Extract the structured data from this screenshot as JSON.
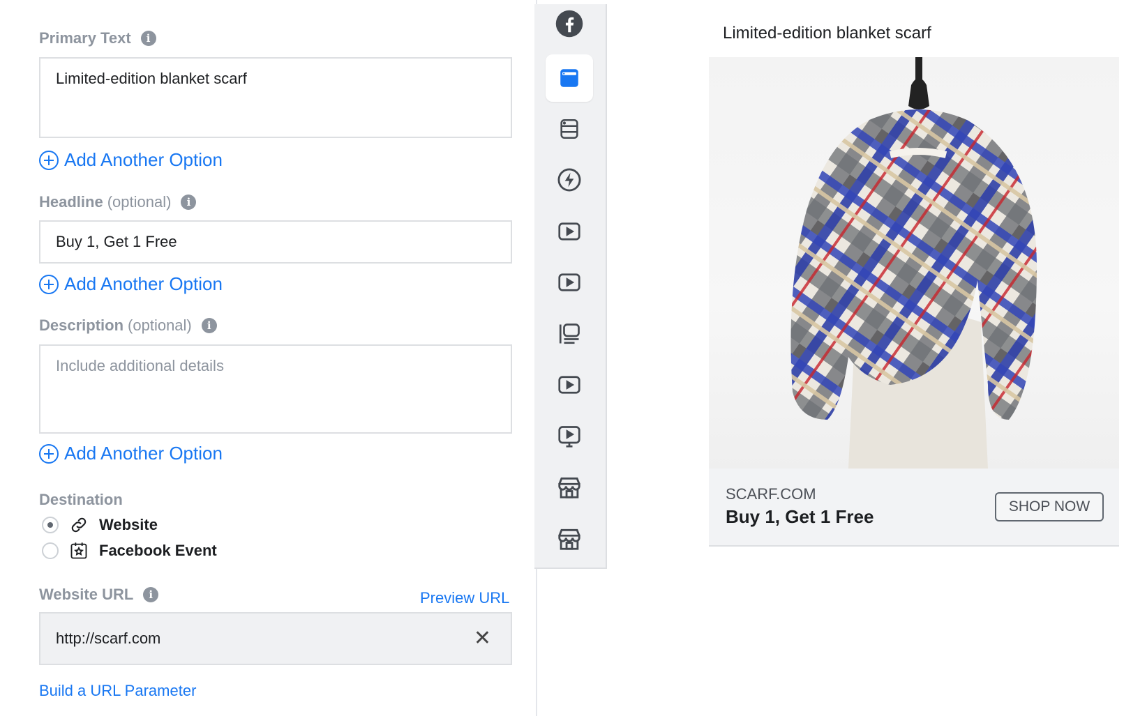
{
  "form": {
    "primary_text": {
      "label": "Primary Text",
      "value": "Limited-edition blanket scarf",
      "add_option": "Add Another Option"
    },
    "headline": {
      "label": "Headline",
      "optional": "(optional)",
      "value": "Buy 1, Get 1 Free",
      "add_option": "Add Another Option"
    },
    "description": {
      "label": "Description",
      "optional": "(optional)",
      "placeholder": "Include additional details",
      "add_option": "Add Another Option"
    },
    "destination": {
      "label": "Destination",
      "options": [
        {
          "label": "Website",
          "icon": "link-icon",
          "selected": true
        },
        {
          "label": "Facebook Event",
          "icon": "calendar-star-icon",
          "selected": false
        }
      ]
    },
    "website_url": {
      "label": "Website URL",
      "preview_link": "Preview URL",
      "value": "http://scarf.com",
      "build_param_link": "Build a URL Parameter"
    },
    "info_glyph": "i"
  },
  "placements": {
    "items": [
      {
        "icon": "facebook-logo-icon",
        "active": false
      },
      {
        "icon": "feed-icon",
        "active": true
      },
      {
        "icon": "article-icon",
        "active": false
      },
      {
        "icon": "instant-article-icon",
        "active": false
      },
      {
        "icon": "video-icon",
        "active": false
      },
      {
        "icon": "video-icon",
        "active": false
      },
      {
        "icon": "stories-icon",
        "active": false
      },
      {
        "icon": "video-icon",
        "active": false
      },
      {
        "icon": "in-stream-video-icon",
        "active": false
      },
      {
        "icon": "marketplace-icon",
        "active": false
      },
      {
        "icon": "marketplace-icon",
        "active": false
      }
    ]
  },
  "preview": {
    "title": "Limited-edition blanket scarf",
    "domain": "SCARF.COM",
    "headline": "Buy 1, Get 1 Free",
    "cta": "SHOP NOW"
  },
  "colors": {
    "link_blue": "#1877f2",
    "label_grey": "#8d949e",
    "active_icon_blue": "#1877f2",
    "icon_dark": "#444950"
  }
}
